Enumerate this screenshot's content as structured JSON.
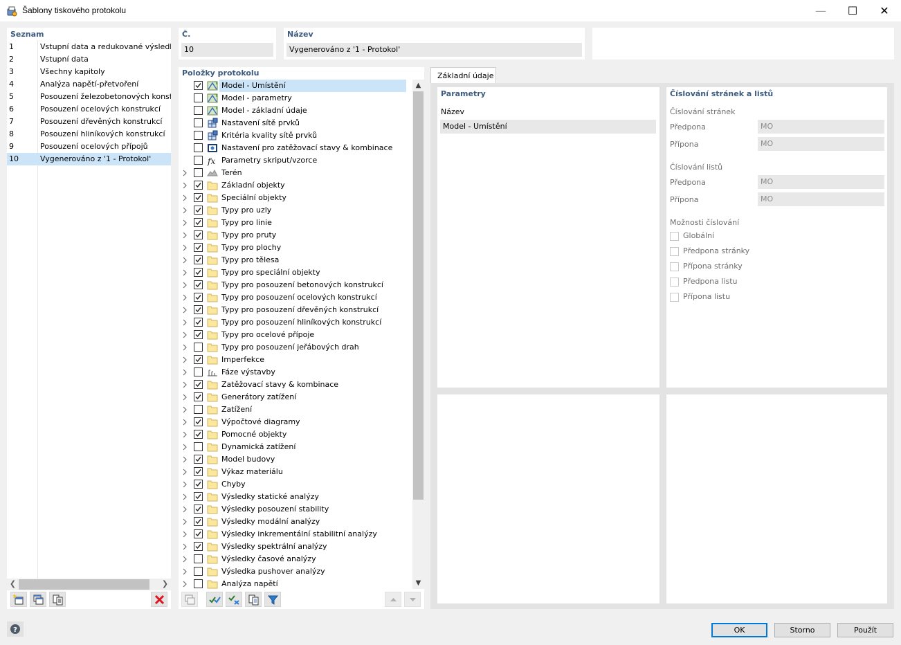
{
  "window": {
    "title": "Šablony tiskového protokolu"
  },
  "list": {
    "header": "Seznam",
    "items": [
      {
        "num": "1",
        "name": "Vstupní data a redukované výsledky"
      },
      {
        "num": "2",
        "name": "Vstupní data"
      },
      {
        "num": "3",
        "name": "Všechny kapitoly"
      },
      {
        "num": "4",
        "name": "Analýza napětí-přetvoření"
      },
      {
        "num": "5",
        "name": "Posouzení železobetonových konstrukcí"
      },
      {
        "num": "6",
        "name": "Posouzení ocelových konstrukcí"
      },
      {
        "num": "7",
        "name": "Posouzení dřevěných konstrukcí"
      },
      {
        "num": "8",
        "name": "Posouzení hliníkových konstrukcí"
      },
      {
        "num": "9",
        "name": "Posouzení ocelových přípojů"
      },
      {
        "num": "10",
        "name": "Vygenerováno z '1 - Protokol'"
      }
    ],
    "selected_index": 9
  },
  "number_field": {
    "label": "Č.",
    "value": "10"
  },
  "name_field": {
    "label": "Název",
    "value": "Vygenerováno z '1 - Protokol'"
  },
  "items_panel": {
    "header": "Položky protokolu",
    "items": [
      {
        "label": "Model - Umístění",
        "checked": true,
        "expandable": false,
        "icon": "model-icon"
      },
      {
        "label": "Model - parametry",
        "checked": false,
        "expandable": false,
        "icon": "model-icon"
      },
      {
        "label": "Model - základní údaje",
        "checked": false,
        "expandable": false,
        "icon": "model-icon"
      },
      {
        "label": "Nastavení sítě prvků",
        "checked": false,
        "expandable": false,
        "icon": "mesh-icon"
      },
      {
        "label": "Kritéria kvality sítě prvků",
        "checked": false,
        "expandable": false,
        "icon": "mesh-icon"
      },
      {
        "label": "Nastavení pro zatěžovací stavy & kombinace",
        "checked": false,
        "expandable": false,
        "icon": "load-settings-icon"
      },
      {
        "label": "Parametry skriput/vzorce",
        "checked": false,
        "expandable": false,
        "icon": "formula-icon"
      },
      {
        "label": "Terén",
        "checked": false,
        "expandable": true,
        "icon": "terrain-icon"
      },
      {
        "label": "Základní objekty",
        "checked": true,
        "expandable": true,
        "icon": "folder-icon"
      },
      {
        "label": "Speciální objekty",
        "checked": true,
        "expandable": true,
        "icon": "folder-icon"
      },
      {
        "label": "Typy pro uzly",
        "checked": true,
        "expandable": true,
        "icon": "folder-icon"
      },
      {
        "label": "Typy pro linie",
        "checked": true,
        "expandable": true,
        "icon": "folder-icon"
      },
      {
        "label": "Typy pro pruty",
        "checked": true,
        "expandable": true,
        "icon": "folder-icon"
      },
      {
        "label": "Typy pro plochy",
        "checked": true,
        "expandable": true,
        "icon": "folder-icon"
      },
      {
        "label": "Typy pro tělesa",
        "checked": true,
        "expandable": true,
        "icon": "folder-icon"
      },
      {
        "label": "Typy pro speciální objekty",
        "checked": true,
        "expandable": true,
        "icon": "folder-icon"
      },
      {
        "label": "Typy pro posouzení betonových konstrukcí",
        "checked": true,
        "expandable": true,
        "icon": "folder-icon"
      },
      {
        "label": "Typy pro posouzení ocelových konstrukcí",
        "checked": true,
        "expandable": true,
        "icon": "folder-icon"
      },
      {
        "label": "Typy pro posouzení dřevěných konstrukcí",
        "checked": true,
        "expandable": true,
        "icon": "folder-icon"
      },
      {
        "label": "Typy pro posouzení hliníkových konstrukcí",
        "checked": true,
        "expandable": true,
        "icon": "folder-icon"
      },
      {
        "label": "Typy pro ocelové přípoje",
        "checked": true,
        "expandable": true,
        "icon": "folder-icon"
      },
      {
        "label": "Typy pro posouzení jeřábových drah",
        "checked": false,
        "expandable": true,
        "icon": "folder-icon"
      },
      {
        "label": "Imperfekce",
        "checked": true,
        "expandable": true,
        "icon": "folder-icon"
      },
      {
        "label": "Fáze výstavby",
        "checked": false,
        "expandable": true,
        "icon": "construction-stages-icon"
      },
      {
        "label": "Zatěžovací stavy & kombinace",
        "checked": true,
        "expandable": true,
        "icon": "folder-icon"
      },
      {
        "label": "Generátory zatížení",
        "checked": true,
        "expandable": true,
        "icon": "folder-icon"
      },
      {
        "label": "Zatížení",
        "checked": false,
        "expandable": true,
        "icon": "folder-icon"
      },
      {
        "label": "Výpočtové diagramy",
        "checked": true,
        "expandable": true,
        "icon": "folder-icon"
      },
      {
        "label": "Pomocné objekty",
        "checked": true,
        "expandable": true,
        "icon": "folder-icon"
      },
      {
        "label": "Dynamická zatížení",
        "checked": false,
        "expandable": true,
        "icon": "folder-icon"
      },
      {
        "label": "Model budovy",
        "checked": true,
        "expandable": true,
        "icon": "folder-icon"
      },
      {
        "label": "Výkaz materiálu",
        "checked": true,
        "expandable": true,
        "icon": "folder-icon"
      },
      {
        "label": "Chyby",
        "checked": true,
        "expandable": true,
        "icon": "folder-icon"
      },
      {
        "label": "Výsledky statické analýzy",
        "checked": true,
        "expandable": true,
        "icon": "folder-icon"
      },
      {
        "label": "Výsledky posouzení stability",
        "checked": true,
        "expandable": true,
        "icon": "folder-icon"
      },
      {
        "label": "Výsledky modální analýzy",
        "checked": true,
        "expandable": true,
        "icon": "folder-icon"
      },
      {
        "label": "Výsledky inkrementální stabilitní analýzy",
        "checked": true,
        "expandable": true,
        "icon": "folder-icon"
      },
      {
        "label": "Výsledky spektrální analýzy",
        "checked": true,
        "expandable": true,
        "icon": "folder-icon"
      },
      {
        "label": "Výsledky časové analýzy",
        "checked": false,
        "expandable": true,
        "icon": "folder-icon"
      },
      {
        "label": "Výsledka pushover analýzy",
        "checked": false,
        "expandable": true,
        "icon": "folder-icon"
      },
      {
        "label": "Analýza napětí",
        "checked": false,
        "expandable": true,
        "icon": "folder-icon"
      }
    ],
    "selected_index": 0
  },
  "tab": {
    "label": "Základní údaje"
  },
  "params": {
    "header": "Parametry",
    "name_label": "Název",
    "name_value": "Model - Umístění"
  },
  "numbering": {
    "header": "Číslování stránek a listů",
    "pages_label": "Číslování stránek",
    "sheets_label": "Číslování listů",
    "prefix_label": "Předpona",
    "suffix_label": "Přípona",
    "page_prefix": "MO",
    "page_suffix": "MO",
    "sheet_prefix": "MO",
    "sheet_suffix": "MO",
    "options_label": "Možnosti číslování",
    "options": [
      "Globální",
      "Předpona stránky",
      "Přípona stránky",
      "Předpona listu",
      "Přípona listu"
    ]
  },
  "buttons": {
    "ok": "OK",
    "cancel": "Storno",
    "apply": "Použít"
  },
  "colors": {
    "accent": "#0078d7",
    "selection": "#cce4f7",
    "section_title": "#3d5a80",
    "delete": "#e0141e"
  }
}
